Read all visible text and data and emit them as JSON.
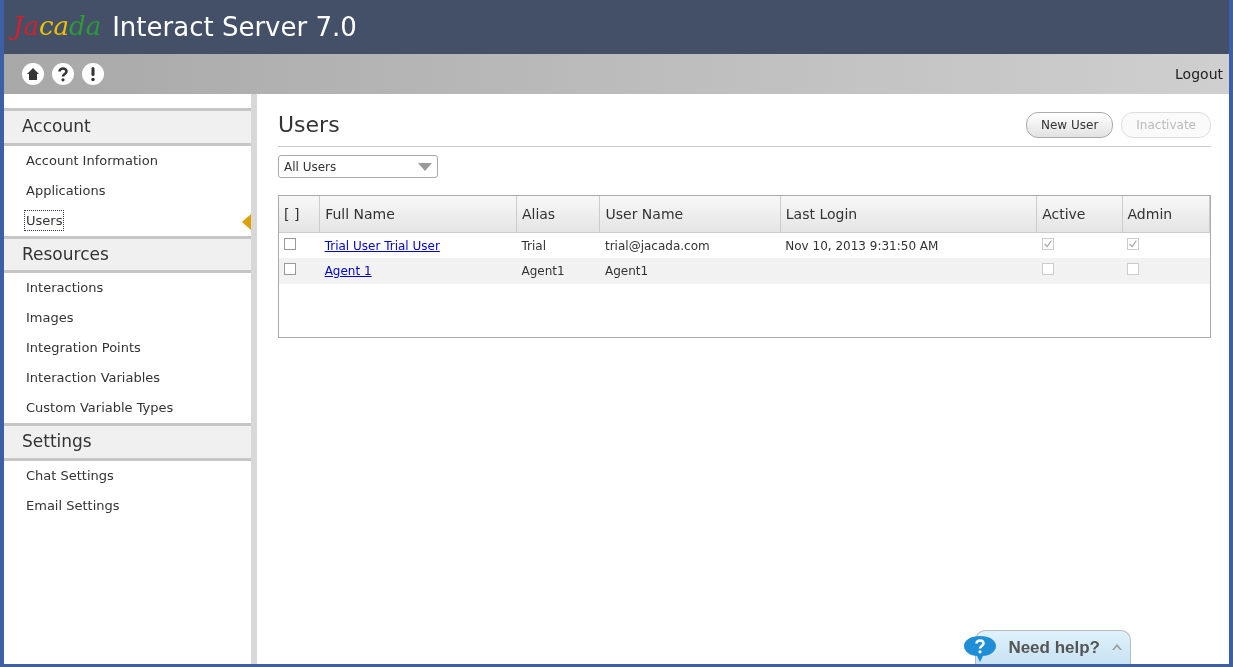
{
  "header": {
    "logo": "Jacada",
    "title": "Interact Server 7.0"
  },
  "toolbar": {
    "logout": "Logout"
  },
  "sidebar": [
    {
      "heading": "Account",
      "items": [
        {
          "label": "Account Information",
          "selected": false
        },
        {
          "label": "Applications",
          "selected": false
        },
        {
          "label": "Users",
          "selected": true
        }
      ]
    },
    {
      "heading": "Resources",
      "items": [
        {
          "label": "Interactions",
          "selected": false
        },
        {
          "label": "Images",
          "selected": false
        },
        {
          "label": "Integration Points",
          "selected": false
        },
        {
          "label": "Interaction Variables",
          "selected": false
        },
        {
          "label": "Custom Variable Types",
          "selected": false
        }
      ]
    },
    {
      "heading": "Settings",
      "items": [
        {
          "label": "Chat Settings",
          "selected": false
        },
        {
          "label": "Email Settings",
          "selected": false
        }
      ]
    }
  ],
  "page": {
    "title": "Users",
    "buttons": [
      {
        "label": "New User",
        "disabled": false
      },
      {
        "label": "Inactivate",
        "disabled": true
      }
    ],
    "filter": "All Users"
  },
  "table": {
    "columns": [
      "[ ]",
      "Full Name",
      "Alias",
      "User Name",
      "Last Login",
      "Active",
      "Admin"
    ],
    "rows": [
      {
        "selected": false,
        "checked": false,
        "full_name": "Trial User Trial User",
        "alias": "Trial",
        "user_name": "trial@jacada.com",
        "last_login": "Nov 10, 2013 9:31:50 AM",
        "active": true,
        "admin": true
      },
      {
        "selected": true,
        "checked": false,
        "full_name": "Agent 1",
        "alias": "Agent1",
        "user_name": "Agent1",
        "last_login": "",
        "active": false,
        "admin": false
      }
    ]
  },
  "help": {
    "label": "Need help?"
  }
}
